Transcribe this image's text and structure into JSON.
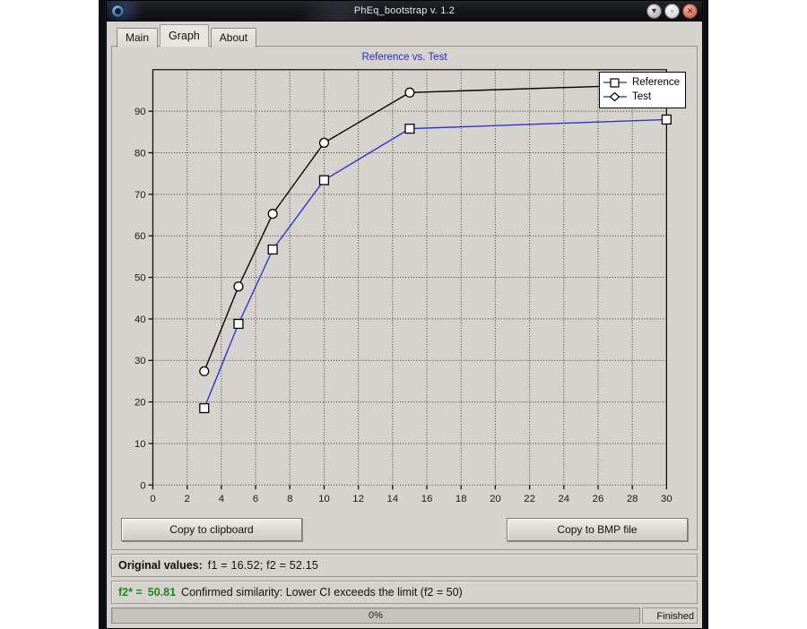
{
  "window": {
    "title": "PhEq_bootstrap v. 1.2",
    "icon": "app-circle-icon",
    "buttons": [
      {
        "name": "minimize",
        "glyph": "▼"
      },
      {
        "name": "maximize",
        "glyph": "▫"
      },
      {
        "name": "close",
        "glyph": "✕"
      }
    ]
  },
  "tabs": [
    {
      "label": "Main",
      "selected": false
    },
    {
      "label": "Graph",
      "selected": true
    },
    {
      "label": "About",
      "selected": false
    }
  ],
  "toolbar": {
    "copy_clipboard_label": "Copy to clipboard",
    "copy_bmp_label": "Copy to BMP file"
  },
  "results": {
    "original_label": "Original values:",
    "original_values": "f1 =  16.52;   f2 =  52.15",
    "f2star_label": "f2* =",
    "f2star_value": "50.81",
    "conclusion": "Confirmed similarity: Lower CI exceeds the limit (f2 = 50)"
  },
  "status": {
    "progress_text": "0%",
    "progress_percent": 0,
    "state_label": "Finished"
  },
  "colors": {
    "test_line": "#000000",
    "reference_line": "#3333cc",
    "title": "#2b2bc8",
    "plot_background": "#d6d2cd",
    "grid": "#3a3a3a",
    "success_text": "#1a8a1a"
  },
  "chart_data": {
    "type": "line",
    "title": "Reference vs. Test",
    "xlabel": "",
    "ylabel": "",
    "xlim": [
      0,
      30
    ],
    "ylim": [
      0,
      100
    ],
    "xticks": [
      0,
      2,
      4,
      6,
      8,
      10,
      12,
      14,
      16,
      18,
      20,
      22,
      24,
      26,
      28,
      30
    ],
    "yticks": [
      0,
      10,
      20,
      30,
      40,
      50,
      60,
      70,
      80,
      90
    ],
    "grid": true,
    "legend_position": "top-right",
    "x": [
      3,
      5,
      7,
      10,
      15,
      30
    ],
    "series": [
      {
        "name": "Reference",
        "marker": "square",
        "color": "#3333cc",
        "values": [
          18.5,
          38.8,
          56.7,
          73.4,
          85.8,
          88.0
        ]
      },
      {
        "name": "Test",
        "marker": "circle",
        "color": "#000000",
        "values": [
          27.4,
          47.8,
          65.3,
          82.4,
          94.5,
          96.5
        ]
      }
    ]
  }
}
